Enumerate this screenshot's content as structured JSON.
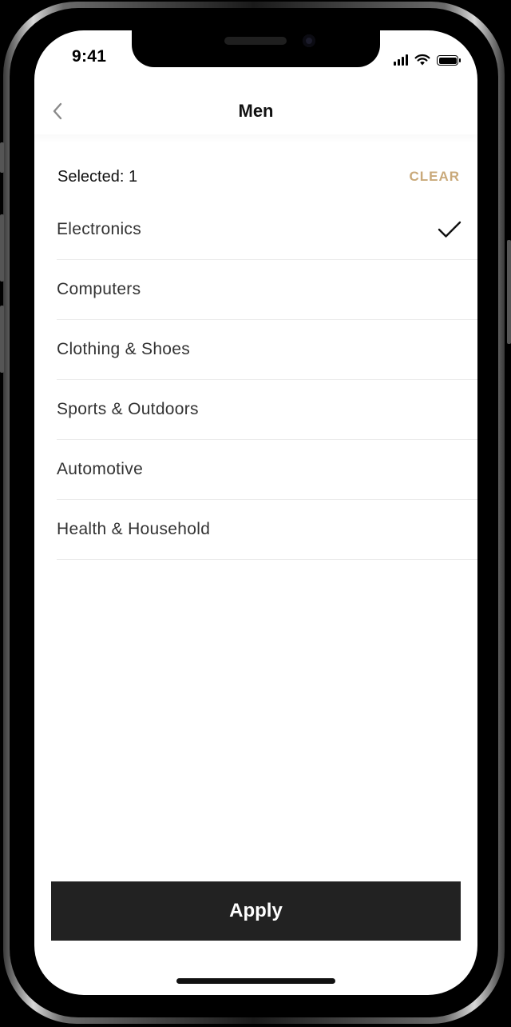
{
  "status_bar": {
    "time": "9:41",
    "icons": [
      "signal-icon",
      "wifi-icon",
      "battery-icon"
    ]
  },
  "nav": {
    "back_icon": "chevron-left-icon",
    "title": "Men"
  },
  "selection": {
    "selected_label": "Selected: 1",
    "clear_label": "CLEAR"
  },
  "categories": [
    {
      "label": "Electronics",
      "checked": true
    },
    {
      "label": "Computers",
      "checked": false
    },
    {
      "label": "Clothing & Shoes",
      "checked": false
    },
    {
      "label": "Sports & Outdoors",
      "checked": false
    },
    {
      "label": "Automotive",
      "checked": false
    },
    {
      "label": "Health & Household",
      "checked": false
    }
  ],
  "apply_label": "Apply",
  "colors": {
    "accent": "#c9a97a",
    "button_bg": "#222222",
    "text": "#333333"
  }
}
